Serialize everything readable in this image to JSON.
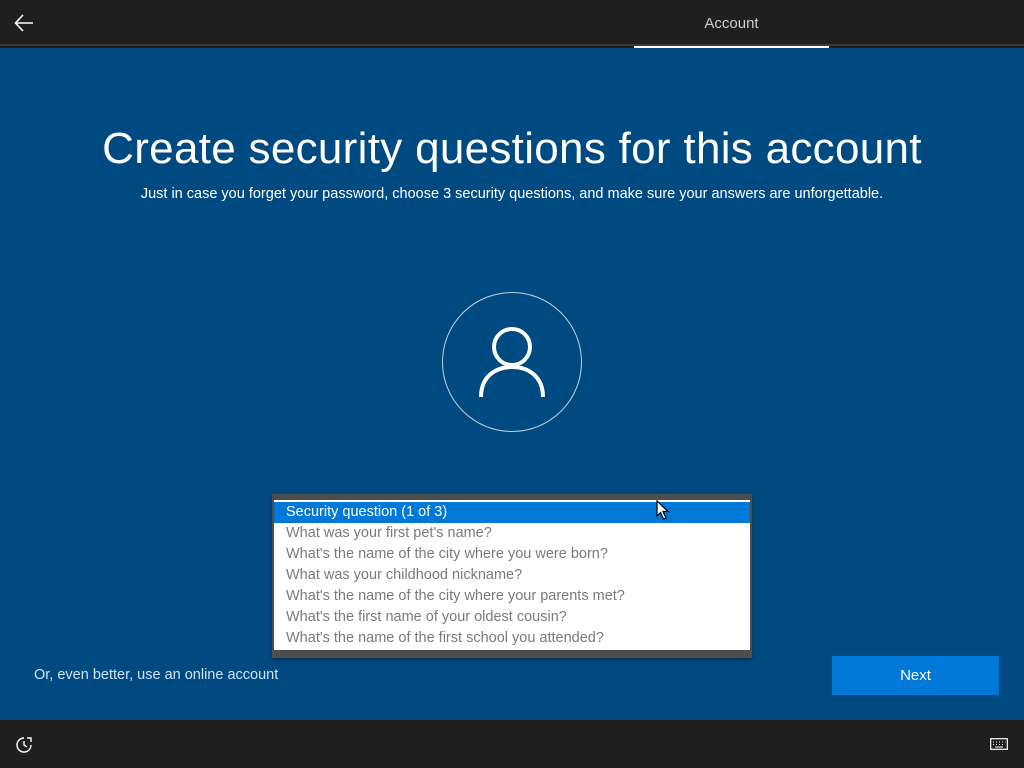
{
  "header": {
    "back_icon": "back-arrow-icon",
    "tab_label": "Account"
  },
  "main": {
    "title": "Create security questions for this account",
    "subtitle": "Just in case you forget your password, choose 3 security questions, and make sure your answers are unforgettable.",
    "avatar_icon": "user-icon",
    "background_color": "#004a82"
  },
  "security_dropdown": {
    "selected": "Security question (1 of 3)",
    "options": [
      "Security question (1 of 3)",
      "What was your first pet's name?",
      "What's the name of the city where you were born?",
      "What was your childhood nickname?",
      "What's the name of the city where your parents met?",
      "What's the first name of your oldest cousin?",
      "What's the name of the first school you attended?"
    ],
    "highlight_color": "#0078d7"
  },
  "footer": {
    "online_account_link": "Or, even better, use an online account",
    "next_label": "Next",
    "accent_color": "#0078d7"
  },
  "bottom_bar": {
    "ease_of_access_icon": "ease-of-access-icon",
    "keyboard_icon": "keyboard-icon"
  }
}
